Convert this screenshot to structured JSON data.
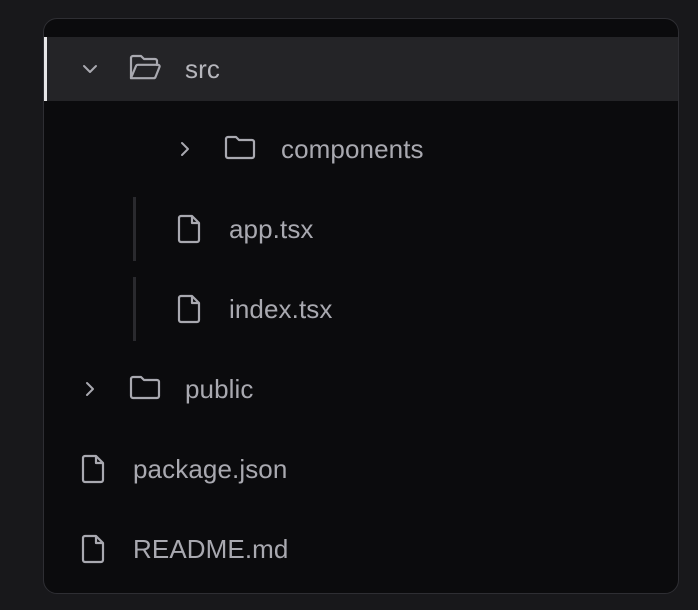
{
  "tree": {
    "items": [
      {
        "label": "src",
        "type": "folder",
        "state": "expanded",
        "selected": true,
        "icon": "folder-open-icon",
        "chevron": "chevron-down-icon"
      },
      {
        "label": "components",
        "type": "folder",
        "state": "collapsed",
        "icon": "folder-icon",
        "chevron": "chevron-right-icon"
      },
      {
        "label": "app.tsx",
        "type": "file",
        "icon": "file-icon"
      },
      {
        "label": "index.tsx",
        "type": "file",
        "icon": "file-icon"
      },
      {
        "label": "public",
        "type": "folder",
        "state": "collapsed",
        "icon": "folder-icon",
        "chevron": "chevron-right-icon"
      },
      {
        "label": "package.json",
        "type": "file",
        "icon": "file-icon"
      },
      {
        "label": "README.md",
        "type": "file",
        "icon": "file-icon"
      }
    ]
  },
  "colors": {
    "background": "#18181b",
    "panel": "#0b0b0d",
    "selected_row": "#242427",
    "selection_indicator": "#e6e6e8",
    "text": "#a9a9b0",
    "guide": "#2a2a2e"
  }
}
